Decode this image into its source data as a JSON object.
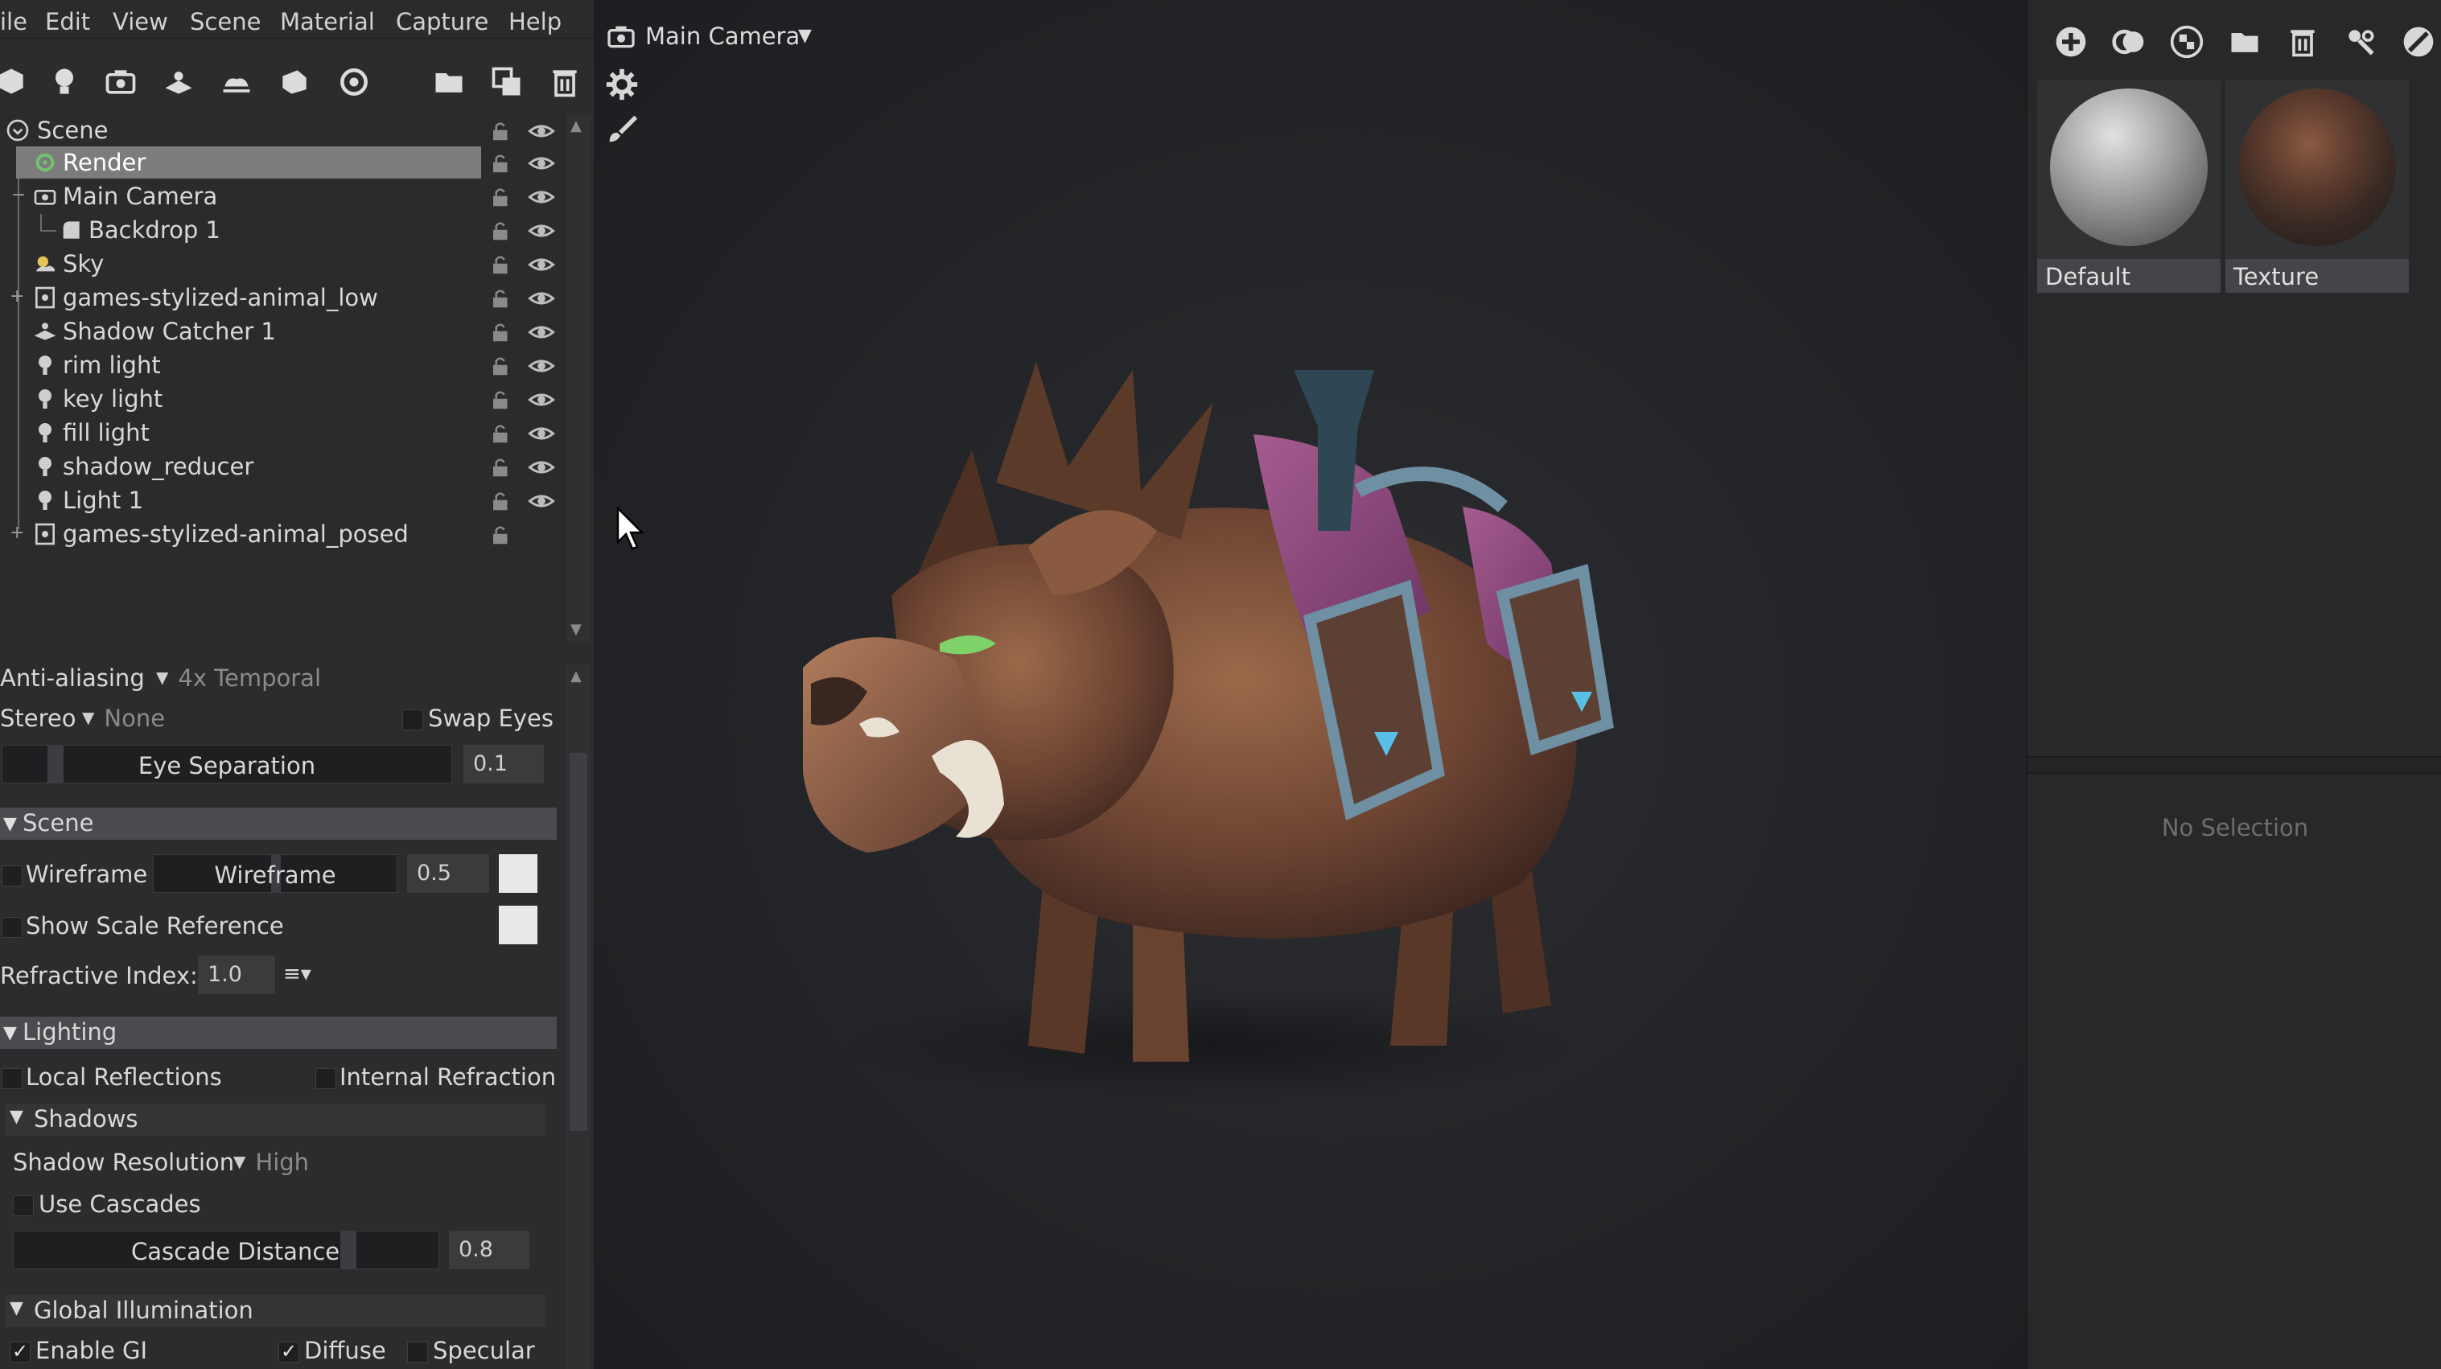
{
  "menu": [
    "ile",
    "Edit",
    "View",
    "Scene",
    "Material",
    "Capture",
    "Help"
  ],
  "viewport": {
    "camera_label": "Main Camera"
  },
  "tree": {
    "rows": [
      {
        "label": "Scene"
      },
      {
        "label": "Render"
      },
      {
        "label": "Main Camera"
      },
      {
        "label": "Backdrop 1"
      },
      {
        "label": "Sky"
      },
      {
        "label": "games-stylized-animal_low"
      },
      {
        "label": "Shadow Catcher 1"
      },
      {
        "label": "rim light"
      },
      {
        "label": "key light"
      },
      {
        "label": "fill light"
      },
      {
        "label": "shadow_reducer"
      },
      {
        "label": "Light 1"
      },
      {
        "label": "games-stylized-animal_posed"
      }
    ]
  },
  "props": {
    "antialias_label": "Anti-aliasing",
    "antialias_value": "4x Temporal",
    "stereo_label": "Stereo",
    "stereo_value": "None",
    "swap_eyes": "Swap Eyes",
    "eye_sep_label": "Eye Separation",
    "eye_sep_value": "0.1",
    "scene_section": "Scene",
    "wireframe_check": "Wireframe",
    "wireframe_slider": "Wireframe",
    "wireframe_value": "0.5",
    "scale_ref": "Show Scale Reference",
    "refr_label": "Refractive Index:",
    "refr_value": "1.0",
    "lighting_section": "Lighting",
    "local_refl": "Local Reflections",
    "internal_refr": "Internal Refraction",
    "shadows_section": "Shadows",
    "shadow_res_label": "Shadow Resolution",
    "shadow_res_value": "High",
    "use_cascades": "Use Cascades",
    "cascade_label": "Cascade Distance",
    "cascade_value": "0.8",
    "gi_section": "Global Illumination",
    "enable_gi": "Enable GI",
    "diffuse": "Diffuse",
    "specular": "Specular"
  },
  "materials": [
    {
      "label": "Default"
    },
    {
      "label": "Texture"
    }
  ],
  "inspector": {
    "empty_text": "No Selection"
  }
}
